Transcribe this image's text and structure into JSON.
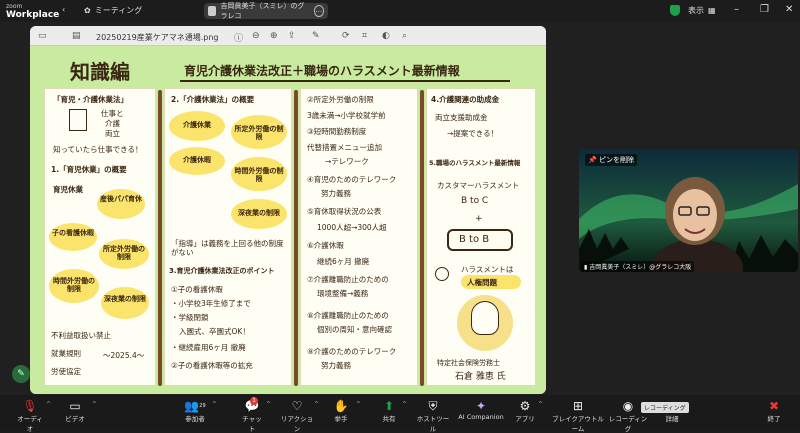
{
  "app": {
    "brand_small": "zoom",
    "brand": "Workplace"
  },
  "titlebar": {
    "meeting_label": "ミーティング",
    "share_label": "吉岡眞美子（スミレ）のグラレコ",
    "view_label": "表示"
  },
  "document": {
    "filename": "20250219産業ケアマネ通場.png"
  },
  "poster": {
    "chapter": "知識編",
    "headline": "育児介護休業法改正＋職場のハラスメント最新情報",
    "col1": {
      "header": "「育児・介護休業法」",
      "label_before": "仕事と",
      "label_care": "介護",
      "label_both": "両立",
      "note": "知っていたら仕事できる！",
      "sec1": "1.「育児休業」の概要",
      "items": [
        "育児休業",
        "産後パパ育休",
        "子の看護休暇",
        "所定外労働の制限",
        "時間外労働の制限",
        "深夜業の制限"
      ],
      "footer1": "不利益取扱い禁止",
      "footer2": "就業規則",
      "footer3": "〜2025.4〜",
      "footer4": "労使協定"
    },
    "col2": {
      "sec2": "2.「介護休業法」の概要",
      "items": [
        "介護休業",
        "介護休暇",
        "所定外労働の制限",
        "時間外労働の制限",
        "深夜業の制限"
      ],
      "note": "「指導」は義務を上回る他の制度がない",
      "sec3": "3.育児介護休業法改正のポイント",
      "points": [
        "①子の看護休暇",
        "・小学校3年生修了まで",
        "・学級閉鎖",
        "入園式、卒園式OK！",
        "・継続雇用6ヶ月 撤廃",
        "②子の看護休暇等の拡充"
      ]
    },
    "col3": {
      "lines": [
        "②所定外労働の制限",
        "3歳未満→小学校就学前",
        "③短時間勤務制度",
        "代替措置メニュー追加",
        "→テレワーク",
        "④育児のためのテレワーク",
        "努力義務",
        "⑤育休取得状況の公表",
        "1000人超→300人超",
        "⑥介護休暇",
        "継続6ヶ月 撤廃",
        "⑦介護離職防止のための",
        "環境整備→義務",
        "⑧介護離職防止のための",
        "個別の周知・意向確認",
        "⑨介護のためのテレワーク",
        "努力義務"
      ]
    },
    "col4": {
      "lines": [
        "4.介護関連の助成金",
        "両立支援助成金",
        "→提案できる！",
        "5.職場のハラスメント最新情報",
        "カスタマーハラスメント",
        "B to C",
        "+",
        "B to B",
        "ハラスメントは",
        "人権問題",
        "特定社会保険労務士",
        "石倉 雅恵 氏"
      ]
    }
  },
  "video": {
    "pin_label": "ピンを削除",
    "participant": "吉岡眞美子（スミレ）@グラレコ大阪"
  },
  "toolbar": {
    "audio": "オーディオ",
    "video": "ビデオ",
    "participants": "参加者",
    "participants_count": "29",
    "chat": "チャット",
    "chat_badge": "1",
    "reactions": "リアクション",
    "raise_hand": "挙手",
    "share": "共有",
    "host_tools": "ホストツール",
    "ai": "AI Companion",
    "apps": "アプリ",
    "breakout": "ブレイクアウトルーム",
    "record": "レコーディング",
    "details": "詳細",
    "end": "終了",
    "record_tooltip": "レコーディング"
  },
  "colors": {
    "poster_bg": "#c8eb9f",
    "highlight": "#fbe46b",
    "ink": "#3a2613",
    "end_red": "#e53935",
    "share_green": "#1aa34a"
  }
}
